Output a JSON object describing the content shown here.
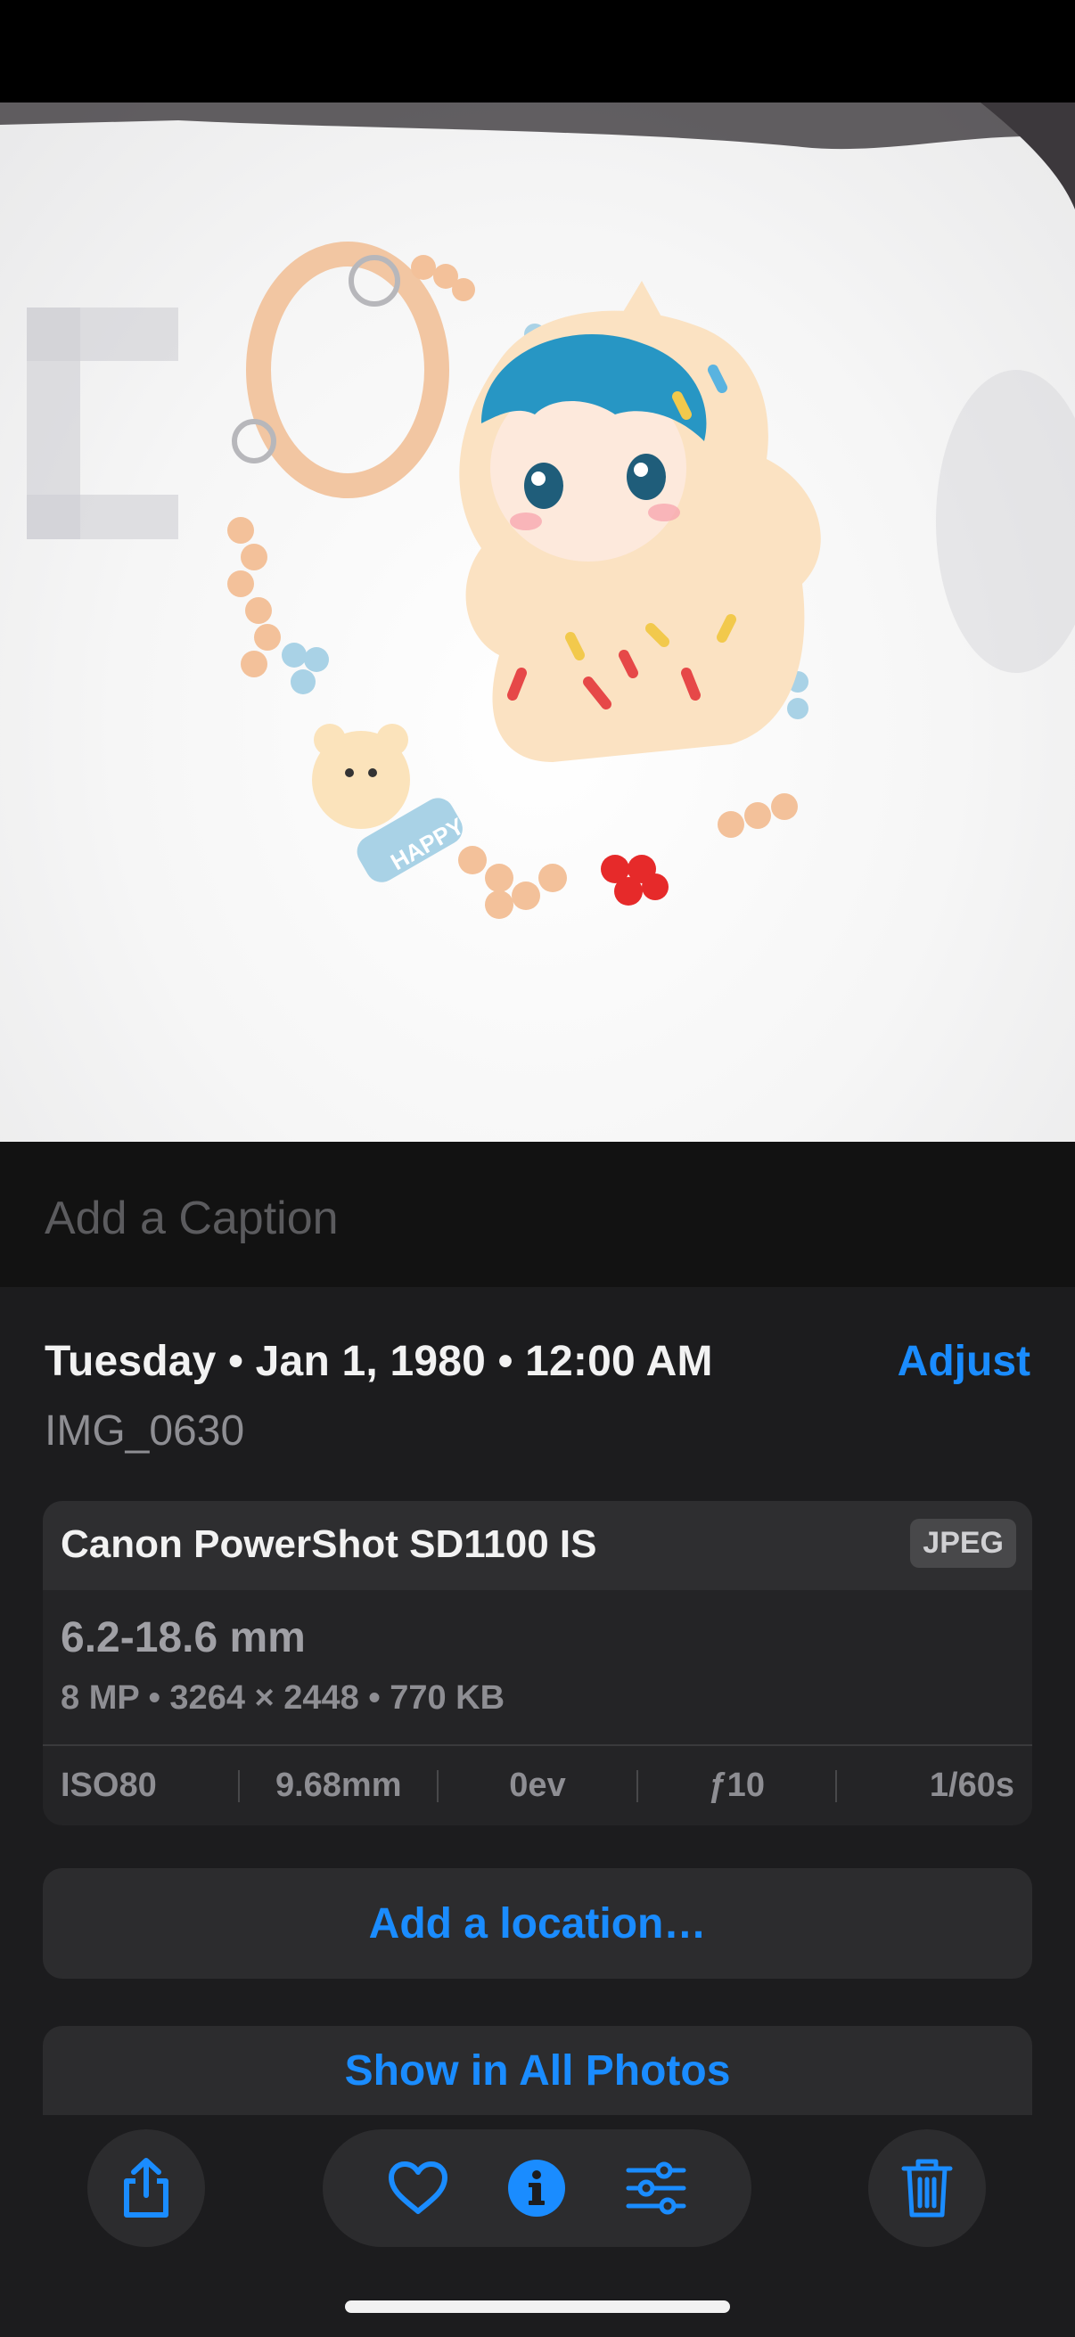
{
  "caption": {
    "placeholder": "Add a Caption"
  },
  "info": {
    "date": "Tuesday • Jan 1, 1980 • 12:00 AM",
    "adjust_label": "Adjust",
    "filename": "IMG_0630"
  },
  "camera": {
    "model": "Canon PowerShot SD1100 IS",
    "format_badge": "JPEG",
    "lens": "6.2-18.6 mm",
    "specs": "8 MP • 3264 × 2448 • 770 KB",
    "exif": {
      "iso": "ISO80",
      "focal_length": "9.68mm",
      "exposure": "0ev",
      "aperture": "ƒ10",
      "shutter": "1/60s"
    }
  },
  "actions": {
    "add_location": "Add a location…",
    "show_in_all_photos": "Show in All Photos"
  },
  "toolbar": {
    "icons": [
      "share-icon",
      "heart-icon",
      "info-icon",
      "adjust-sliders-icon",
      "trash-icon"
    ],
    "accent_color": "#1a8cff"
  },
  "photo": {
    "badge_text": "HAPPY"
  }
}
